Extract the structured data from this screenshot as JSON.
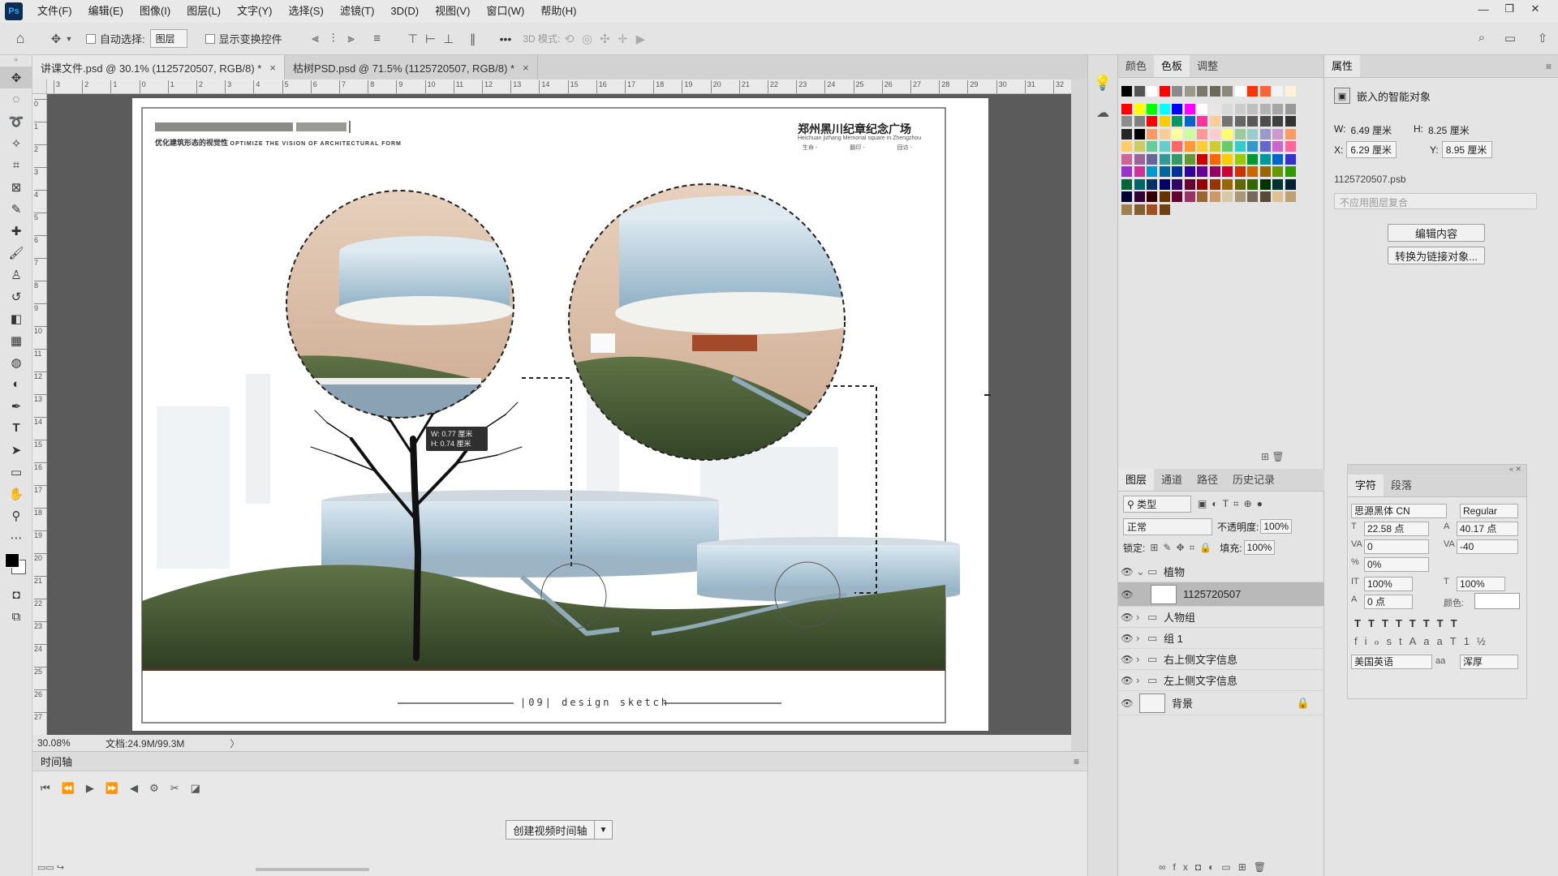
{
  "app": {
    "logo": "Ps"
  },
  "menu": [
    "文件(F)",
    "编辑(E)",
    "图像(I)",
    "图层(L)",
    "文字(Y)",
    "选择(S)",
    "滤镜(T)",
    "3D(D)",
    "视图(V)",
    "窗口(W)",
    "帮助(H)"
  ],
  "options": {
    "auto_select": "自动选择:",
    "layer_select": "图层",
    "show_transform": "显示变换控件",
    "mode3d": "3D 模式:",
    "more": "•••"
  },
  "tabs": [
    {
      "label": "讲课文件.psd @ 30.1% (1125720507, RGB/8) *"
    },
    {
      "label": "枯树PSD.psd @ 71.5% (1125720507, RGB/8) *"
    }
  ],
  "ruler_h": [
    "3",
    "2",
    "1",
    "0",
    "1",
    "2",
    "3",
    "4",
    "5",
    "6",
    "7",
    "8",
    "9",
    "10",
    "11",
    "12",
    "13",
    "14",
    "15",
    "16",
    "17",
    "18",
    "19",
    "20",
    "21",
    "22",
    "23",
    "24",
    "25",
    "26",
    "27",
    "28",
    "29",
    "30",
    "31",
    "32"
  ],
  "ruler_v": [
    "0",
    "1",
    "2",
    "3",
    "4",
    "5",
    "6",
    "7",
    "8",
    "9",
    "10",
    "11",
    "12",
    "13",
    "14",
    "15",
    "16",
    "17",
    "18",
    "19",
    "20",
    "21",
    "22",
    "23",
    "24",
    "25",
    "26",
    "27"
  ],
  "artwork": {
    "title_cn": "郑州黑川纪章纪念广场",
    "title_en": "Heichuan jizhang Memorial square in Zhengzhou",
    "subtitle_cn": "优化建筑形态的视觉性",
    "subtitle_en": "OPTIMIZE THE VISION OF ARCHITECTURAL FORM",
    "meta": [
      "生命 -",
      "翻印 -",
      "回访 -"
    ],
    "footer": "|09| design sketch",
    "tooltip_w": "W: 0.77 厘米",
    "tooltip_h": "H: 0.74 厘米"
  },
  "status": {
    "zoom": "30.08%",
    "doc": "文档:24.9M/99.3M"
  },
  "timeline": {
    "title": "时间轴",
    "create_btn": "创建视频时间轴"
  },
  "swatch_panel": {
    "tabs": [
      "颜色",
      "色板",
      "调整"
    ]
  },
  "layers_panel": {
    "tabs": [
      "图层",
      "通道",
      "路径",
      "历史记录"
    ],
    "filter": "类型",
    "blend": "正常",
    "opacity_label": "不透明度:",
    "opacity": "100%",
    "lock_label": "锁定:",
    "fill_label": "填充:",
    "fill": "100%",
    "layers": [
      {
        "name": "植物",
        "type": "group",
        "open": true
      },
      {
        "name": "1125720507",
        "type": "smart"
      },
      {
        "name": "人物组",
        "type": "group"
      },
      {
        "name": "组 1",
        "type": "group"
      },
      {
        "name": "右上侧文字信息",
        "type": "group"
      },
      {
        "name": "左上侧文字信息",
        "type": "group"
      },
      {
        "name": "背景",
        "type": "bg"
      }
    ]
  },
  "properties": {
    "tab": "属性",
    "kind": "嵌入的智能对象",
    "w_label": "W:",
    "w": "6.49 厘米",
    "h_label": "H:",
    "h": "8.25 厘米",
    "x_label": "X:",
    "x": "6.29 厘米",
    "y_label": "Y:",
    "y": "8.95 厘米",
    "file": "1125720507.psb",
    "comp": "不应用图层复合",
    "edit_btn": "编辑内容",
    "convert_btn": "转换为链接对象..."
  },
  "character": {
    "tabs": [
      "字符",
      "段落"
    ],
    "font": "思源黑体 CN",
    "style": "Regular",
    "size": "22.58 点",
    "leading": "40.17 点",
    "kerning": "0",
    "tracking": "-40",
    "scale_pct": "0%",
    "vscale": "100%",
    "hscale": "100%",
    "baseline": "0 点",
    "color_label": "颜色:",
    "lang": "美国英语",
    "aa": "浑厚"
  },
  "colors": {
    "accent": "#31a8ff",
    "canvas_bg": "#5b5b5b",
    "panel": "#e4e4e4"
  },
  "swatches": [
    "#000000",
    "#555555",
    "#ffffff",
    "#ff0000",
    "#8a8a8a",
    "#9a9a8a",
    "#7a7a6a",
    "#6a6a5a",
    "#8a8a7a",
    "#ffffff",
    "#ff3300",
    "#ff6633",
    "#f2f2f2",
    "#fff2d9",
    "#ff0000",
    "#ffff00",
    "#00ff00",
    "#00ffff",
    "#0000ff",
    "#ff00ff",
    "#ffffff",
    "#e6e6e6",
    "#d9d9d9",
    "#cccccc",
    "#bfbfbf",
    "#b3b3b3",
    "#a6a6a6",
    "#999999",
    "#8c8c8c",
    "#808080",
    "#ff0000",
    "#ffcc00",
    "#009966",
    "#0066cc",
    "#ff3399",
    "#ffcc99",
    "#737373",
    "#666666",
    "#595959",
    "#4d4d4d",
    "#404040",
    "#333333",
    "#262626",
    "#000000",
    "#ff9966",
    "#ffcc99",
    "#ffff99",
    "#ccff99",
    "#ff9999",
    "#ffcccc",
    "#ffff66",
    "#99cc99",
    "#99cccc",
    "#9999cc",
    "#cc99cc",
    "#ff9966",
    "#ffcc66",
    "#cccc66",
    "#66cc99",
    "#66cccc",
    "#ff6666",
    "#ff9933",
    "#ffcc33",
    "#cccc33",
    "#66cc66",
    "#33cccc",
    "#3399cc",
    "#6666cc",
    "#cc66cc",
    "#ff6699",
    "#cc6699",
    "#996699",
    "#666699",
    "#339999",
    "#339966",
    "#669933",
    "#cc0000",
    "#ff6600",
    "#ffcc00",
    "#99cc00",
    "#009933",
    "#009999",
    "#0066cc",
    "#3333cc",
    "#9933cc",
    "#cc3399",
    "#0099cc",
    "#006699",
    "#003399",
    "#330099",
    "#660099",
    "#990066",
    "#cc0033",
    "#cc3300",
    "#cc6600",
    "#996600",
    "#669900",
    "#339900",
    "#006633",
    "#006666",
    "#003366",
    "#000066",
    "#330066",
    "#660033",
    "#990000",
    "#993300",
    "#996600",
    "#666600",
    "#336600",
    "#003300",
    "#003333",
    "#002233",
    "#000033",
    "#330033",
    "#330000",
    "#663300",
    "#660033",
    "#993366",
    "#996633",
    "#cc9966",
    "#d9c8a8",
    "#a89878",
    "#786858",
    "#584838",
    "#e0c090",
    "#c0a070",
    "#a08050",
    "#806030",
    "#a05020",
    "#704010"
  ]
}
